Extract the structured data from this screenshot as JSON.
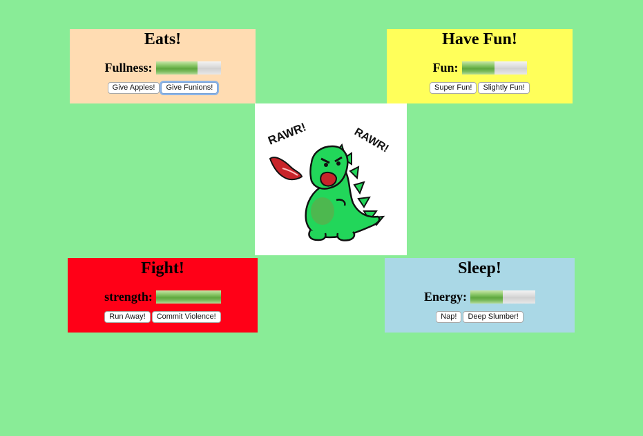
{
  "page": {
    "background_color": "#89ec97"
  },
  "eats": {
    "title": "Eats!",
    "stat_label": "Fullness:",
    "bar_fraction": 0.64,
    "color": "#ffdcb2",
    "buttons": [
      "Give Apples!",
      "Give Funions!"
    ]
  },
  "fun": {
    "title": "Have Fun!",
    "stat_label": "Fun:",
    "bar_fraction": 0.5,
    "color": "#ffff5a",
    "buttons": [
      "Super Fun!",
      "Slightly Fun!"
    ]
  },
  "fight": {
    "title": "Fight!",
    "stat_label": "strength:",
    "bar_fraction": 1.0,
    "color": "#ff0017",
    "buttons": [
      "Run Away!",
      "Commit Violence!"
    ]
  },
  "sleep": {
    "title": "Sleep!",
    "stat_label": "Energy:",
    "bar_fraction": 0.5,
    "color": "#aad8e6",
    "buttons": [
      "Nap!",
      "Deep Slumber!"
    ]
  },
  "dino": {
    "text_left": "RAWR!",
    "text_right": "RAWR!",
    "body_color": "#22d65a"
  }
}
